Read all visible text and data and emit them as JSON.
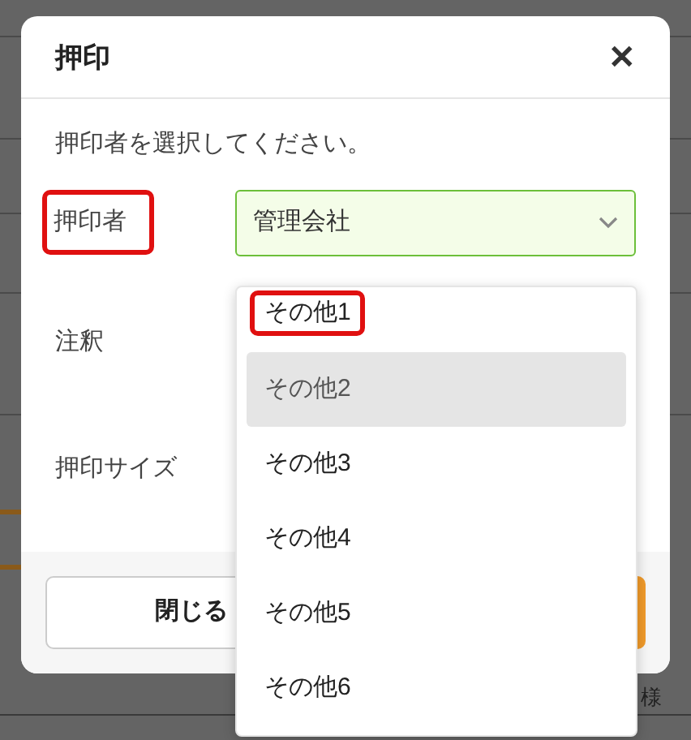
{
  "background": {
    "label": "様"
  },
  "dialog": {
    "title": "押印",
    "close": "✕",
    "prompt": "押印者を選択してください。",
    "fields": [
      {
        "label": "押印者",
        "annotated": true,
        "kind": "select",
        "value": "管理会社",
        "open": true
      },
      {
        "label": "注釈",
        "annotated": false,
        "kind": "hidden"
      },
      {
        "label": "押印サイズ",
        "annotated": false,
        "kind": "hidden"
      }
    ],
    "options": [
      {
        "label": "その他1",
        "selected": false,
        "annotated": true
      },
      {
        "label": "その他2",
        "selected": true,
        "annotated": false
      },
      {
        "label": "その他3",
        "selected": false,
        "annotated": false
      },
      {
        "label": "その他4",
        "selected": false,
        "annotated": false
      },
      {
        "label": "その他5",
        "selected": false,
        "annotated": false
      },
      {
        "label": "その他6",
        "selected": false,
        "annotated": false
      }
    ],
    "buttons": [
      {
        "label": "閉じる",
        "kind": "secondary"
      },
      {
        "kind": "primary"
      }
    ]
  }
}
